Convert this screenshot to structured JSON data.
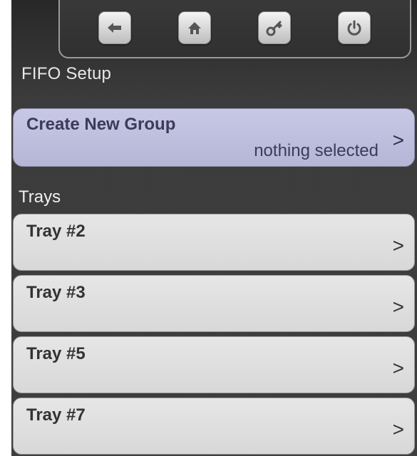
{
  "toolbar": {
    "buttons": [
      {
        "icon": "back-arrow-icon"
      },
      {
        "icon": "home-icon"
      },
      {
        "icon": "key-icon"
      },
      {
        "icon": "power-icon"
      }
    ]
  },
  "page_title": "FIFO Setup",
  "create_group": {
    "title": "Create New Group",
    "status": "nothing selected",
    "chevron": ">"
  },
  "trays_section": {
    "label": "Trays",
    "items": [
      {
        "label": "Tray #2",
        "chevron": ">"
      },
      {
        "label": "Tray #3",
        "chevron": ">"
      },
      {
        "label": "Tray #5",
        "chevron": ">"
      },
      {
        "label": "Tray #7",
        "chevron": ">"
      }
    ]
  },
  "colors": {
    "background": "#3a3a3a",
    "group_card": "#bcbcdc",
    "tray_card": "#dedede",
    "title_text": "#e8e8e8"
  }
}
